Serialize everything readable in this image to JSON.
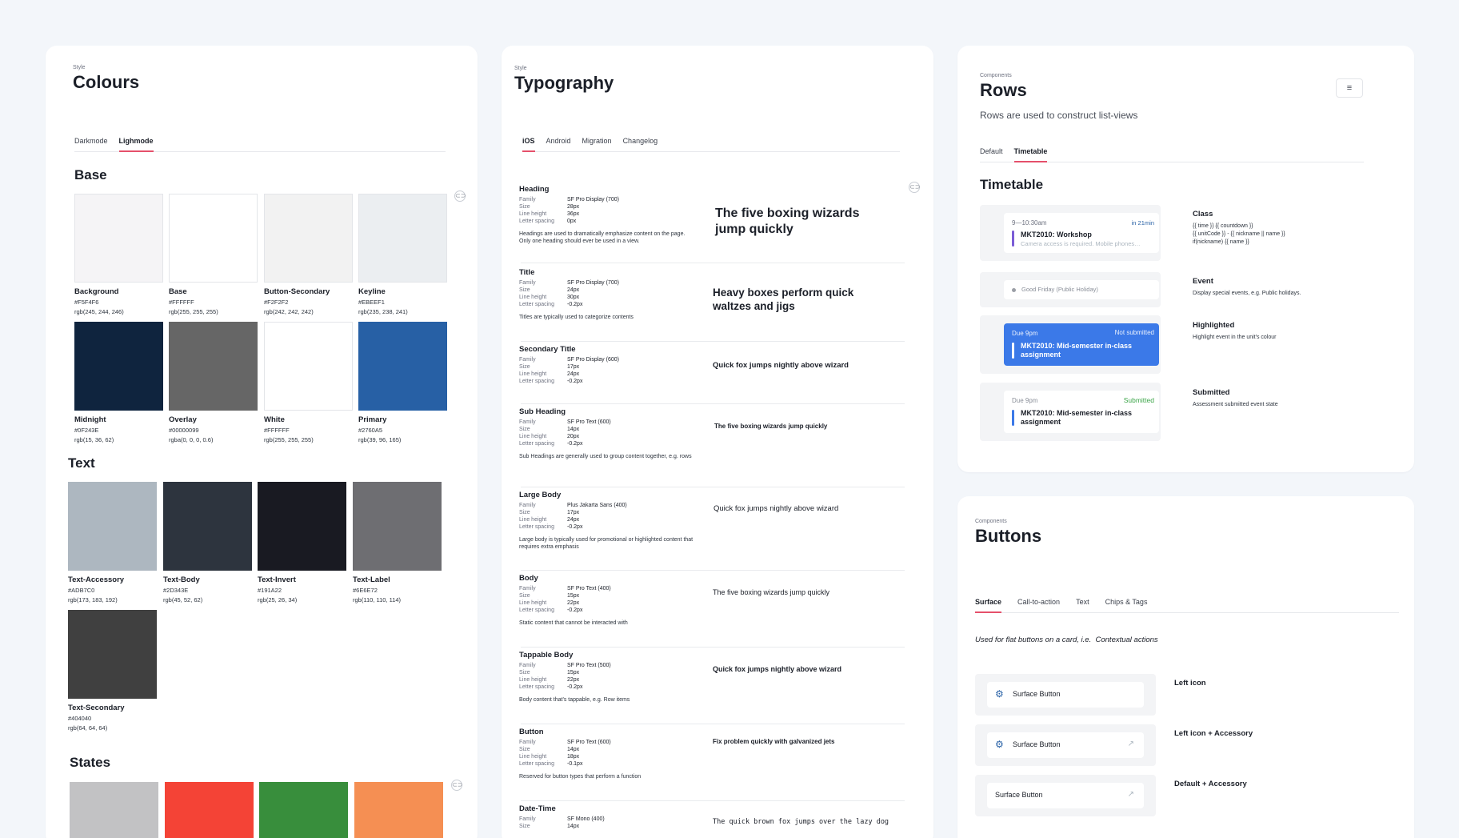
{
  "colours": {
    "overline": "Style",
    "title": "Colours",
    "tabs": [
      "Darkmode",
      "Lighmode"
    ],
    "base_heading": "Base",
    "base": [
      {
        "name": "Background",
        "hex": "#F5F4F6",
        "rgb": "rgb(245, 244, 246)",
        "color": "#F5F4F6"
      },
      {
        "name": "Base",
        "hex": "#FFFFFF",
        "rgb": "rgb(255, 255, 255)",
        "color": "#FFFFFF"
      },
      {
        "name": "Button-Secondary",
        "hex": "#F2F2F2",
        "rgb": "rgb(242, 242, 242)",
        "color": "#F2F2F2"
      },
      {
        "name": "Keyline",
        "hex": "#EBEEF1",
        "rgb": "rgb(235, 238, 241)",
        "color": "#EBEEF1"
      },
      {
        "name": "Midnight",
        "hex": "#0F243E",
        "rgb": "rgb(15, 36, 62)",
        "color": "#0F243E"
      },
      {
        "name": "Overlay",
        "hex": "#00000099",
        "rgb": "rgba(0, 0, 0, 0.6)",
        "color": "#666666"
      },
      {
        "name": "White",
        "hex": "#FFFFFF",
        "rgb": "rgb(255, 255, 255)",
        "color": "#FFFFFF"
      },
      {
        "name": "Primary",
        "hex": "#2760A5",
        "rgb": "rgb(39, 96, 165)",
        "color": "#2760A5"
      }
    ],
    "text_heading": "Text",
    "text": [
      {
        "name": "Text-Accessory",
        "hex": "#ADB7C0",
        "rgb": "rgb(173, 183, 192)",
        "color": "#ADB7C0"
      },
      {
        "name": "Text-Body",
        "hex": "#2D343E",
        "rgb": "rgb(45, 52, 62)",
        "color": "#2D343E"
      },
      {
        "name": "Text-Invert",
        "hex": "#191A22",
        "rgb": "rgb(25, 26, 34)",
        "color": "#191A22"
      },
      {
        "name": "Text-Label",
        "hex": "#6E6E72",
        "rgb": "rgb(110, 110, 114)",
        "color": "#6E6E72"
      },
      {
        "name": "Text-Secondary",
        "hex": "#404040",
        "rgb": "rgb(64, 64, 64)",
        "color": "#404040"
      }
    ],
    "states_heading": "States",
    "states": [
      "#C2C2C4",
      "#F44336",
      "#388E3C",
      "#F58F53"
    ]
  },
  "typography": {
    "overline": "Style",
    "title": "Typography",
    "tabs": [
      "iOS",
      "Android",
      "Migration",
      "Changelog"
    ],
    "keys": {
      "family": "Family",
      "size": "Size",
      "line_height": "Line height",
      "letter_spacing": "Letter spacing"
    },
    "rows": [
      {
        "name": "Heading",
        "family": "SF Pro Display (700)",
        "size": "28px",
        "line_height": "36px",
        "letter_spacing": "0px",
        "desc": "Headings are used to dramatically emphasize content on the page. Only one heading should ever be used in a view.",
        "sample": "The five boxing wizards jump quickly"
      },
      {
        "name": "Title",
        "family": "SF Pro Display (700)",
        "size": "24px",
        "line_height": "30px",
        "letter_spacing": "-0.2px",
        "desc": "Titles are typically used to categorize contents",
        "sample": "Heavy boxes perform quick waltzes and jigs"
      },
      {
        "name": "Secondary Title",
        "family": "SF Pro Display (600)",
        "size": "17px",
        "line_height": "24px",
        "letter_spacing": "-0.2px",
        "desc": "",
        "sample": "Quick fox jumps nightly above wizard"
      },
      {
        "name": "Sub Heading",
        "family": "SF Pro Text (600)",
        "size": "14px",
        "line_height": "20px",
        "letter_spacing": "-0.2px",
        "desc": "Sub Headings are generally used to group content together, e.g. rows",
        "sample": "The five boxing wizards jump quickly"
      },
      {
        "name": "Large Body",
        "family": "Plus Jakarta Sans (400)",
        "size": "17px",
        "line_height": "24px",
        "letter_spacing": "-0.2px",
        "desc": "Large body is typically used for promotional or highlighted content that requires extra emphasis",
        "sample": "Quick fox jumps nightly above wizard"
      },
      {
        "name": "Body",
        "family": "SF Pro Text (400)",
        "size": "15px",
        "line_height": "22px",
        "letter_spacing": "-0.2px",
        "desc": "Static content that cannot be interacted with",
        "sample": "The five boxing wizards jump quickly"
      },
      {
        "name": "Tappable Body",
        "family": "SF Pro Text (500)",
        "size": "15px",
        "line_height": "22px",
        "letter_spacing": "-0.2px",
        "desc": "Body content that's tappable, e.g. Row items",
        "sample": "Quick fox jumps nightly above wizard"
      },
      {
        "name": "Button",
        "family": "SF Pro Text (600)",
        "size": "14px",
        "line_height": "18px",
        "letter_spacing": "-0.1px",
        "desc": "Reserved for button types that perform a function",
        "sample": "Fix problem quickly with galvanized jets"
      },
      {
        "name": "Date-Time",
        "family": "SF Mono (400)",
        "size": "14px",
        "line_height": "",
        "letter_spacing": "",
        "desc": "",
        "sample": "The quick brown fox jumps over the lazy dog"
      }
    ]
  },
  "rows": {
    "overline": "Components",
    "title": "Rows",
    "subtitle": "Rows are used to construct list-views",
    "tabs": [
      "Default",
      "Timetable"
    ],
    "section": "Timetable",
    "items": {
      "class_time": "9—10:30am",
      "class_badge": "in 21min",
      "class_title": "MKT2010: Workshop",
      "class_sub": "Camera access is required. Mobile phones…",
      "class_label": "Class",
      "class_desc_1": "{{ time }} {{ countdown }}",
      "class_desc_2": "{{ unitCode }} - {{ nickname || name }}",
      "class_desc_3": "if(nickname) {{ name }}",
      "event_text": "Good Friday (Public Holiday)",
      "event_label": "Event",
      "event_desc": "Display special events, e.g. Public holidays.",
      "hl_due": "Due 9pm",
      "hl_status": "Not submitted",
      "hl_title": "MKT2010: Mid-semester in-class assignment",
      "hl_label": "Highlighted",
      "hl_desc": "Highlight event in the unit's colour",
      "sub_due": "Due 9pm",
      "sub_status": "Submitted",
      "sub_title": "MKT2010: Mid-semester in-class assignment",
      "sub_label": "Submitted",
      "sub_desc": "Assessment submitted event state"
    }
  },
  "buttons": {
    "overline": "Components",
    "title": "Buttons",
    "tabs": [
      "Surface",
      "Call-to-action",
      "Text",
      "Chips & Tags"
    ],
    "desc": "Used for flat buttons on a card, i.e.  Contextual actions",
    "items": [
      {
        "text": "Surface Button",
        "label": "Left icon"
      },
      {
        "text": "Surface Button",
        "label": "Left icon + Accessory"
      },
      {
        "text": "Surface Button",
        "label": "Default + Accessory"
      }
    ]
  }
}
